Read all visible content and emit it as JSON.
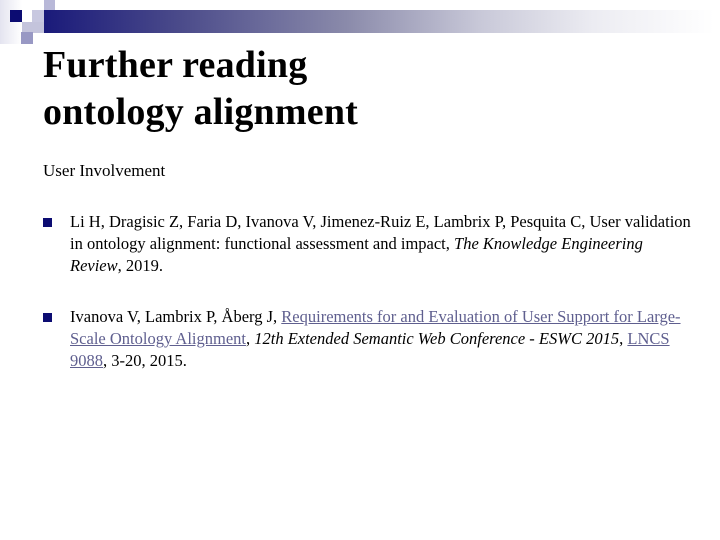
{
  "slide": {
    "title_line1": "Further reading",
    "title_line2": "ontology alignment",
    "subtitle": "User Involvement",
    "colors": {
      "bullet": "#0c0c72",
      "link": "#5f5f8f",
      "bar_start": "#1a1a7a",
      "bar_end": "#ffffff"
    },
    "references": [
      {
        "authors": "Li H, Dragisic Z, Faria D, Ivanova V, Jimenez-Ruiz E, Lambrix P, Pesquita C, User validation in ontology alignment: functional assessment and impact, ",
        "venue": "The Knowledge Engineering Review",
        "tail": ", 2019."
      },
      {
        "authors": "Ivanova V, Lambrix P, Åberg J, ",
        "title_link": "Requirements for and Evaluation of User Support for Large-Scale Ontology Alignment",
        "sep1": ", ",
        "venue": "12th Extended Semantic Web Conference - ESWC 2015",
        "sep2": ", ",
        "series_link": "LNCS 9088",
        "tail": ", 3-20, 2015."
      }
    ]
  }
}
